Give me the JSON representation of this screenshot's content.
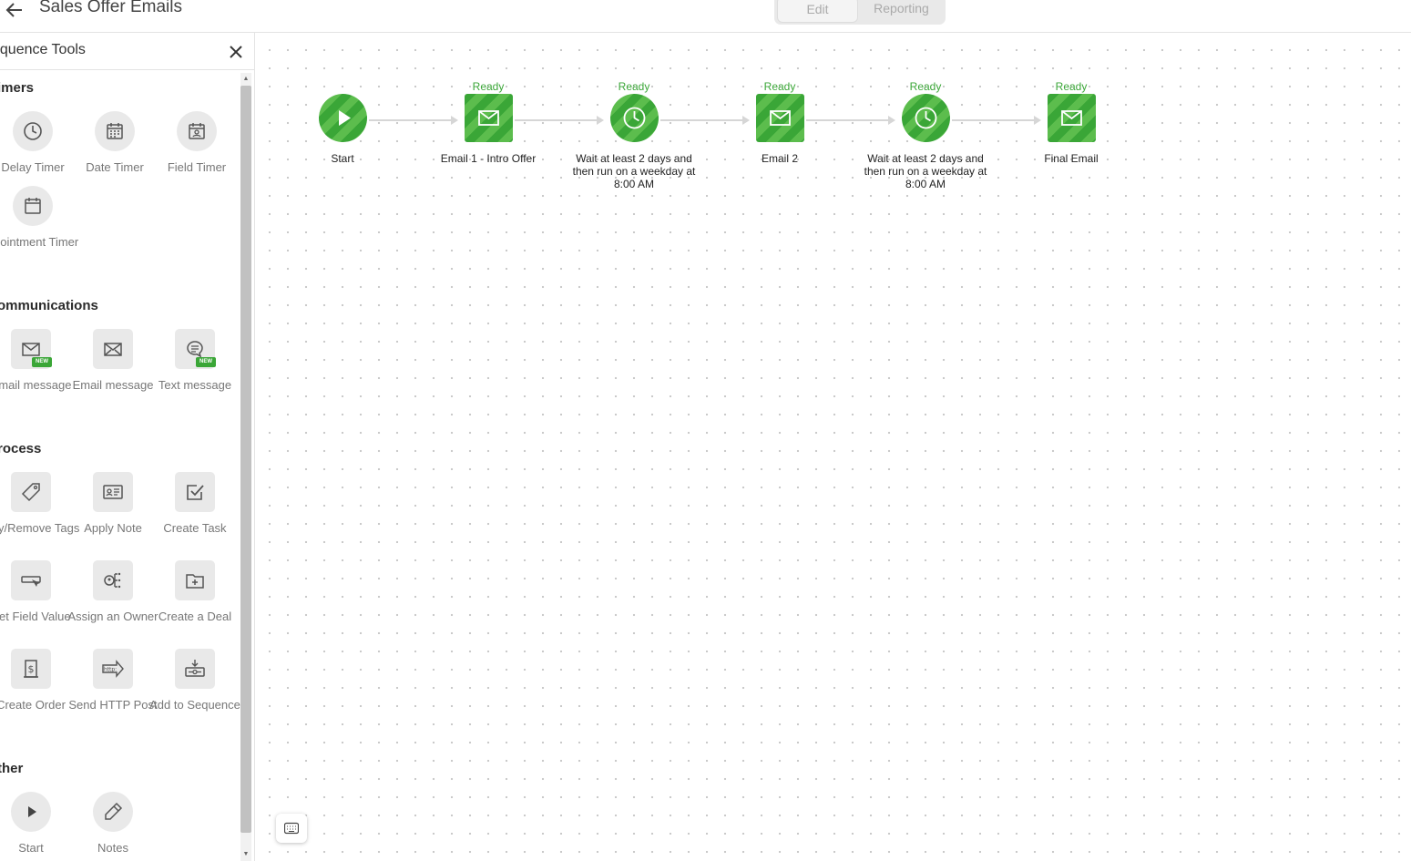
{
  "header": {
    "title": "Sales Offer Emails",
    "tabs": [
      {
        "label": "Edit",
        "active": true
      },
      {
        "label": "Reporting",
        "active": false
      }
    ]
  },
  "sidebar": {
    "title": "equence Tools",
    "sections": {
      "timers": {
        "title": "imers",
        "items": [
          {
            "label": "Delay Timer",
            "icon": "clock-icon"
          },
          {
            "label": "Date Timer",
            "icon": "calendar-grid-icon"
          },
          {
            "label": "Field Timer",
            "icon": "calendar-person-icon"
          },
          {
            "label": "ppointment Timer",
            "icon": "calendar-icon"
          }
        ]
      },
      "communications": {
        "title": "ommunications",
        "items": [
          {
            "label": "Email message",
            "icon": "envelope-icon",
            "badge": "NEW"
          },
          {
            "label": "Email message",
            "icon": "envelope-legacy-icon"
          },
          {
            "label": "Text message",
            "icon": "chat-bubble-icon",
            "badge": "NEW"
          }
        ]
      },
      "process": {
        "title": "rocess",
        "items": [
          {
            "label": "pply/Remove Tags",
            "icon": "tag-icon"
          },
          {
            "label": "Apply Note",
            "icon": "note-card-icon"
          },
          {
            "label": "Create Task",
            "icon": "checkbox-icon"
          },
          {
            "label": "Set Field Value",
            "icon": "field-cursor-icon"
          },
          {
            "label": "Assign an Owner",
            "icon": "assign-owner-icon"
          },
          {
            "label": "Create a Deal",
            "icon": "folder-plus-icon"
          },
          {
            "label": "Create Order",
            "icon": "order-dollar-icon"
          },
          {
            "label": "Send HTTP Post",
            "icon": "http-arrow-icon"
          },
          {
            "label": "Add to Sequence",
            "icon": "add-sequence-icon"
          }
        ]
      },
      "other": {
        "title": "ther",
        "items": [
          {
            "label": "Start",
            "icon": "play-icon"
          },
          {
            "label": "Notes",
            "icon": "pencil-icon"
          }
        ]
      }
    }
  },
  "canvas": {
    "nodes": [
      {
        "label": "Start",
        "status": "",
        "type": "start"
      },
      {
        "label": "Email 1 - Intro Offer",
        "status": "Ready",
        "type": "email"
      },
      {
        "label": "Wait at least 2 days and then run on a weekday at 8:00 AM",
        "status": "Ready",
        "type": "timer"
      },
      {
        "label": "Email 2",
        "status": "Ready",
        "type": "email"
      },
      {
        "label": "Wait at least 2 days and then run on a weekday at 8:00 AM",
        "status": "Ready",
        "type": "timer"
      },
      {
        "label": "Final Email",
        "status": "Ready",
        "type": "email"
      }
    ]
  },
  "colors": {
    "accent_green": "#3aa637",
    "accent_green_light": "#5cbd4d"
  }
}
